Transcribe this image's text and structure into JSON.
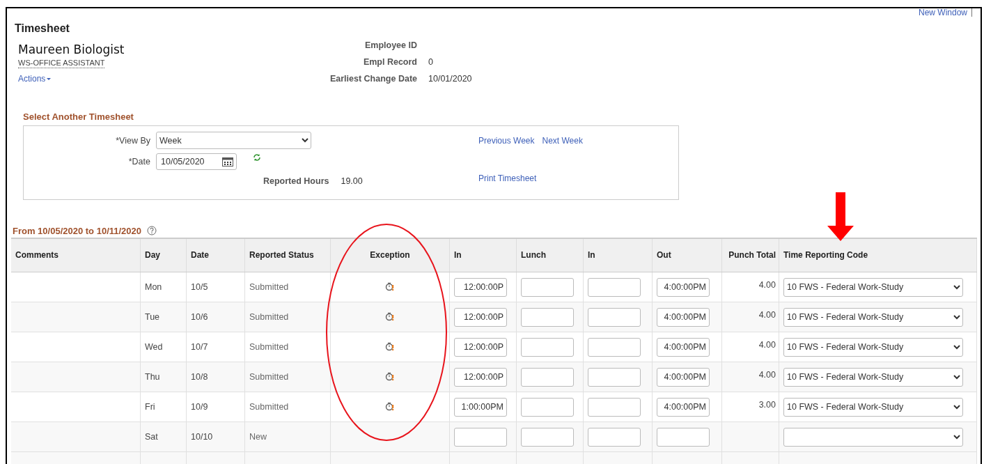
{
  "window": {
    "title": "Timesheet"
  },
  "top_link": "New Window",
  "employee": {
    "name": "Maureen Biologist",
    "job_title": "WS-OFFICE ASSISTANT",
    "actions": "Actions",
    "fields": [
      {
        "label": "Employee ID"
      },
      {
        "label": "Empl Record",
        "value": "0"
      },
      {
        "label": "Earliest Change Date",
        "value": "10/01/2020"
      }
    ]
  },
  "select_timesheet": {
    "title": "Select Another Timesheet",
    "view_by": {
      "label": "*View By",
      "value": "Week"
    },
    "date": {
      "label": "*Date",
      "value": "10/05/2020"
    },
    "reported_hours": {
      "label": "Reported Hours",
      "value": "19.00"
    },
    "links": [
      "Previous Week",
      "Next Week"
    ],
    "print_link": "Print Timesheet"
  },
  "period": {
    "title": "From 10/05/2020 to 10/11/2020"
  },
  "table": {
    "columns": [
      "Comments",
      "Day",
      "Date",
      "Reported Status",
      "Exception",
      "In",
      "Lunch",
      "In",
      "Out",
      "Punch Total",
      "Time Reporting Code"
    ],
    "rows": [
      {
        "day": "Mon",
        "date": "10/5",
        "status": "Submitted",
        "exception": true,
        "in": "12:00:00P",
        "out": "4:00:00PM",
        "punch_total": "4.00",
        "trc": "10 FWS - Federal Work-Study"
      },
      {
        "day": "Tue",
        "date": "10/6",
        "status": "Submitted",
        "exception": true,
        "in": "12:00:00P",
        "out": "4:00:00PM",
        "punch_total": "4.00",
        "trc": "10 FWS - Federal Work-Study"
      },
      {
        "day": "Wed",
        "date": "10/7",
        "status": "Submitted",
        "exception": true,
        "in": "12:00:00P",
        "out": "4:00:00PM",
        "punch_total": "4.00",
        "trc": "10 FWS - Federal Work-Study"
      },
      {
        "day": "Thu",
        "date": "10/8",
        "status": "Submitted",
        "exception": true,
        "in": "12:00:00P",
        "out": "4:00:00PM",
        "punch_total": "4.00",
        "trc": "10 FWS - Federal Work-Study"
      },
      {
        "day": "Fri",
        "date": "10/9",
        "status": "Submitted",
        "exception": true,
        "in": "1:00:00PM",
        "out": "4:00:00PM",
        "punch_total": "3.00",
        "trc": "10 FWS - Federal Work-Study"
      },
      {
        "day": "Sat",
        "date": "10/10",
        "status": "New",
        "exception": false
      }
    ]
  }
}
